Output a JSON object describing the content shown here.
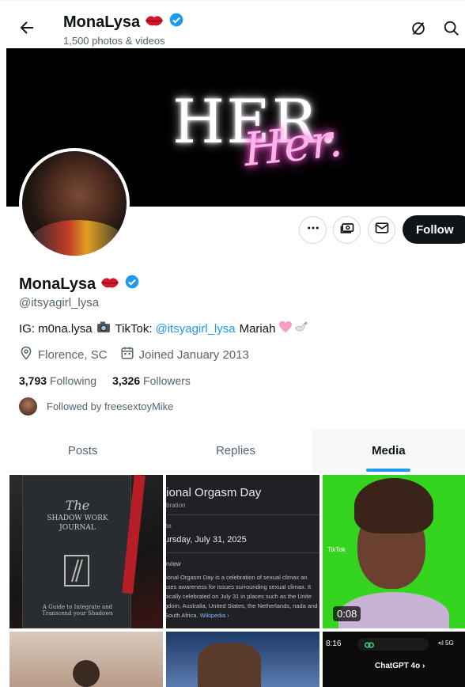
{
  "header": {
    "title": "MonaLysa",
    "subtitle": "1,500 photos & videos"
  },
  "banner": {
    "text_main": "HER.",
    "text_script": "Her."
  },
  "actions": {
    "follow_label": "Follow"
  },
  "profile": {
    "name": "MonaLysa",
    "handle": "@itsyagirl_lysa",
    "bio_ig": "IG: m0na.lysa",
    "bio_tiktok_label": "TikTok:",
    "bio_tiktok_link": "@itsyagirl_lysa",
    "bio_name": "Mariah",
    "location": "Florence, SC",
    "joined": "Joined January 2013",
    "following_count": "3,793",
    "following_label": "Following",
    "followers_count": "3,326",
    "followers_label": "Followers",
    "followed_by": "Followed by freesextoyMike"
  },
  "tabs": [
    {
      "label": "Posts"
    },
    {
      "label": "Replies"
    },
    {
      "label": "Media"
    }
  ],
  "media": {
    "tile1": {
      "title": "The",
      "title2": "SHADOW WORK JOURNAL",
      "subtitle": "A Guide to Integrate and Transcend your Shadows"
    },
    "tile2": {
      "heading": "tional Orgasm Day",
      "kind": "bration",
      "date_label": "te",
      "date": "ursday, July 31, 2025",
      "overview_label": "rview",
      "body": "tional Orgasm Day is a celebration of sexual climax an sses awareness for issues surrounding sexual climax. It pically celebrated on July 31 in places such as the Unite gdom, Australia, United States, the Netherlands, nada and South Africa.",
      "source": "Wikipedia ›"
    },
    "tile3": {
      "watermark": "TikTok",
      "duration": "0:08"
    },
    "tile6": {
      "time": "8:16",
      "signal": "•ıl 5G",
      "app": "ChatGPT 4o ›"
    }
  },
  "colors": {
    "accent": "#1d9bf0",
    "verified": "#1d9bf0",
    "follow_bg": "#0f1419"
  }
}
